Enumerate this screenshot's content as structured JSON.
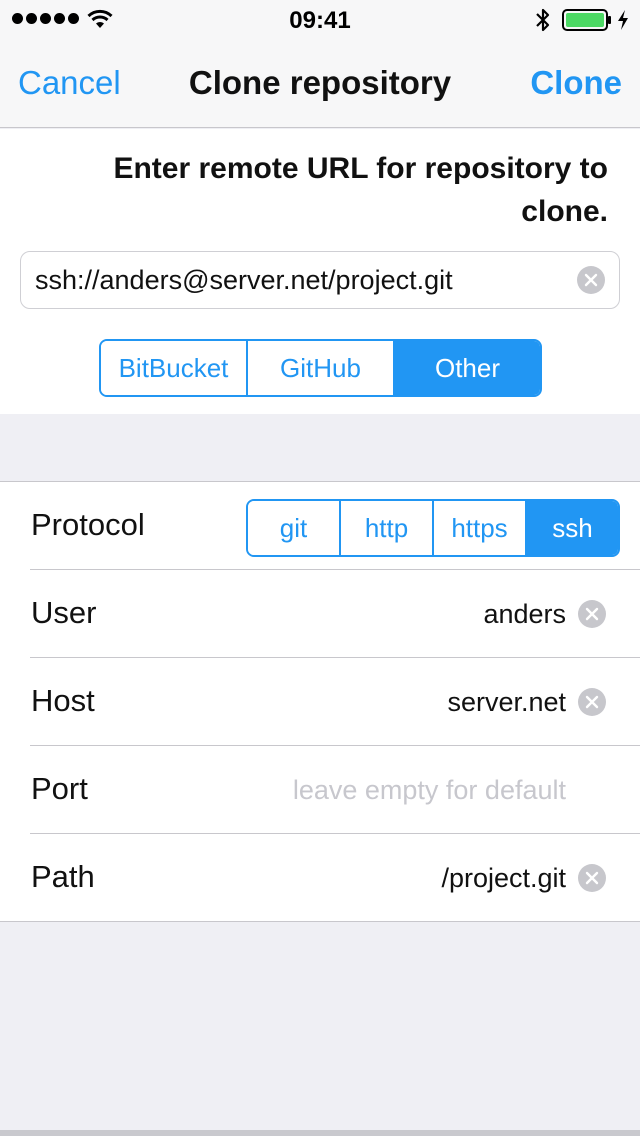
{
  "status_bar": {
    "time": "09:41",
    "signal_icon": "signal-dots-icon",
    "wifi_icon": "wifi-icon",
    "bluetooth_icon": "bluetooth-icon",
    "battery_icon": "battery-charging-icon",
    "battery_color": "#4cd964"
  },
  "nav": {
    "cancel_label": "Cancel",
    "title": "Clone repository",
    "clone_label": "Clone"
  },
  "prompt": "Enter remote URL for repository to clone.",
  "url": {
    "value": "ssh://anders@server.net/project.git"
  },
  "service_segments": {
    "items": [
      "BitBucket",
      "GitHub",
      "Other"
    ],
    "selected": "Other"
  },
  "form": {
    "protocol": {
      "label": "Protocol",
      "options": [
        "git",
        "http",
        "https",
        "ssh"
      ],
      "selected": "ssh"
    },
    "user": {
      "label": "User",
      "value": "anders"
    },
    "host": {
      "label": "Host",
      "value": "server.net"
    },
    "port": {
      "label": "Port",
      "value": "",
      "placeholder": "leave empty for default"
    },
    "path": {
      "label": "Path",
      "value": "/project.git"
    }
  },
  "colors": {
    "accent": "#2196f3",
    "background": "#efeff4",
    "separator": "#c8c7cc",
    "clear_button": "#c7c7cc"
  }
}
